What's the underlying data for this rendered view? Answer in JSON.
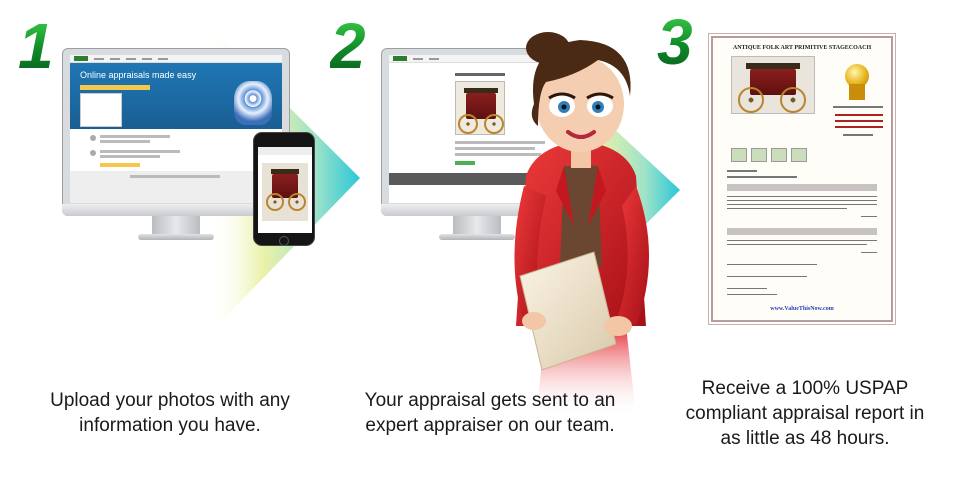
{
  "steps": [
    {
      "number": "1",
      "caption_line1": "Upload your photos with any",
      "caption_line2": "information you have."
    },
    {
      "number": "2",
      "caption_line1": "Your appraisal gets sent to an",
      "caption_line2": "expert appraiser on our team."
    },
    {
      "number": "3",
      "caption_line1": "Receive a 100% USPAP",
      "caption_line2": "compliant appraisal report in",
      "caption_line3": "as little as 48 hours."
    }
  ],
  "website": {
    "hero_title": "Online appraisals made easy"
  },
  "report": {
    "title": "ANTIQUE FOLK ART PRIMITIVE STAGECOACH",
    "footer_link": "www.ValueThisNow.com"
  },
  "colors": {
    "step_number_green": "#0f8a2a",
    "hero_blue": "#1f77b4",
    "jacket_red": "#d01a24",
    "arrow_cyan": "#2ac6d8",
    "arrow_yellow": "#e9f0a0"
  },
  "icons": [
    "arrow-glow-icon",
    "stagecoach-icon",
    "medal-icon"
  ]
}
